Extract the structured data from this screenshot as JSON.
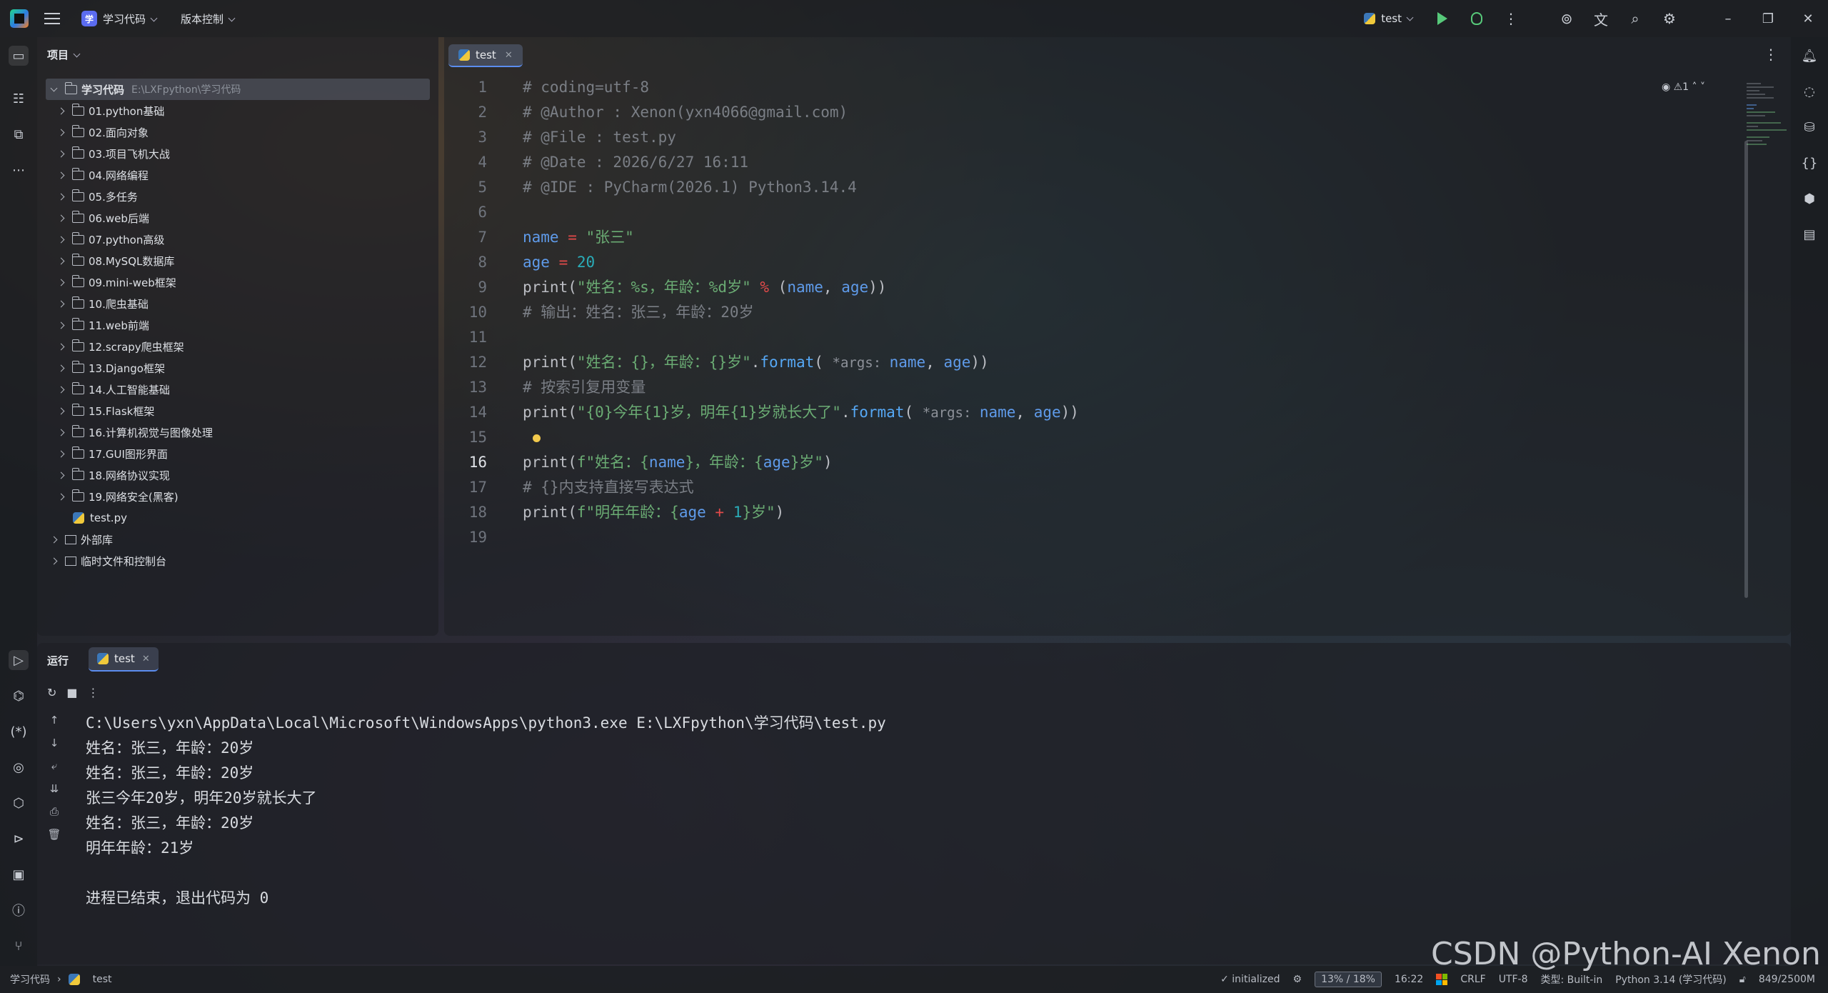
{
  "titlebar": {
    "project_badge": "学",
    "project_name": "学习代码",
    "vcs": "版本控制",
    "run_config": "test",
    "win_min": "–",
    "win_restore": "❐",
    "win_close": "✕"
  },
  "project_panel": {
    "title": "项目",
    "root": {
      "name": "学习代码",
      "path": "E:\\LXFpython\\学习代码"
    },
    "folders": [
      "01.python基础",
      "02.面向对象",
      "03.项目飞机大战",
      "04.网络编程",
      "05.多任务",
      "06.web后端",
      "07.python高级",
      "08.MySQL数据库",
      "09.mini-web框架",
      "10.爬虫基础",
      "11.web前端",
      "12.scrapy爬虫框架",
      "13.Django框架",
      "14.人工智能基础",
      "15.Flask框架",
      "16.计算机视觉与图像处理",
      "17.GUI图形界面",
      "18.网络协议实现",
      "19.网络安全(黑客)"
    ],
    "file": "test.py",
    "external_libs": "外部库",
    "scratches": "临时文件和控制台"
  },
  "editor": {
    "tab": "test",
    "inspection": "⚠1",
    "line_numbers": [
      "1",
      "2",
      "3",
      "4",
      "5",
      "6",
      "7",
      "8",
      "9",
      "10",
      "11",
      "12",
      "13",
      "14",
      "15",
      "16",
      "17",
      "18",
      "19"
    ],
    "lines": {
      "l1": "# coding=utf-8",
      "l2": "# @Author : Xenon(yxn4066@gmail.com)",
      "l3": "# @File : test.py",
      "l4": "# @Date : 2026/6/27 16:11",
      "l5": "# @IDE : PyCharm(2026.1) Python3.14.4",
      "l7_var": "name",
      "l7_op": " = ",
      "l7_str": "\"张三\"",
      "l8_var": "age",
      "l8_op": " = ",
      "l8_num": "20",
      "l9_a": "print(",
      "l9_str": "\"姓名：%s，年龄：%d岁\"",
      "l9_op": " % ",
      "l9_b": "(",
      "l9_v1": "name",
      "l9_c": ", ",
      "l9_v2": "age",
      "l9_d": "))",
      "l10": "# 输出：姓名：张三，年龄：20岁",
      "l12_a": "print(",
      "l12_str": "\"姓名：{}，年龄：{}岁\"",
      "l12_b": ".",
      "l12_fn": "format",
      "l12_c": "( ",
      "l12_hint": "*args: ",
      "l12_v1": "name",
      "l12_d": ", ",
      "l12_v2": "age",
      "l12_e": "))",
      "l13": "# 按索引复用变量",
      "l14_a": "print(",
      "l14_str": "\"{0}今年{1}岁，明年{1}岁就长大了\"",
      "l14_b": ".",
      "l14_fn": "format",
      "l14_c": "( ",
      "l14_hint": "*args: ",
      "l14_v1": "name",
      "l14_d": ", ",
      "l14_v2": "age",
      "l14_e": "))",
      "l16_a": "print(",
      "l16_s1": "f\"姓名：",
      "l16_b1": "{",
      "l16_v1": "name",
      "l16_b2": "}",
      "l16_s2": "，年龄：",
      "l16_b3": "{",
      "l16_v2": "age",
      "l16_b4": "}",
      "l16_s3": "岁\"",
      "l16_e": ")",
      "l17": "# {}内支持直接写表达式",
      "l18_a": "print(",
      "l18_s1": "f\"明年年龄：",
      "l18_b1": "{",
      "l18_v1": "age",
      "l18_op": " + ",
      "l18_num": "1",
      "l18_b2": "}",
      "l18_s2": "岁\"",
      "l18_e": ")"
    }
  },
  "run_panel": {
    "title": "运行",
    "tab": "test",
    "output": [
      "C:\\Users\\yxn\\AppData\\Local\\Microsoft\\WindowsApps\\python3.exe E:\\LXFpython\\学习代码\\test.py",
      "姓名：张三，年龄：20岁",
      "姓名：张三，年龄：20岁",
      "张三今年20岁，明年20岁就长大了",
      "姓名：张三，年龄：20岁",
      "明年年龄：21岁",
      "",
      "进程已结束，退出代码为 0"
    ]
  },
  "statusbar": {
    "crumb_project": "学习代码",
    "crumb_file": "test",
    "initialized": "initialized",
    "mem_usage": "13% / 18%",
    "time": "16:22",
    "line_sep": "CRLF",
    "encoding": "UTF-8",
    "type": "类型: Built-in",
    "interpreter": "Python 3.14 (学习代码)",
    "memory": "849/2500M"
  },
  "watermark": "CSDN @Python-AI Xenon"
}
